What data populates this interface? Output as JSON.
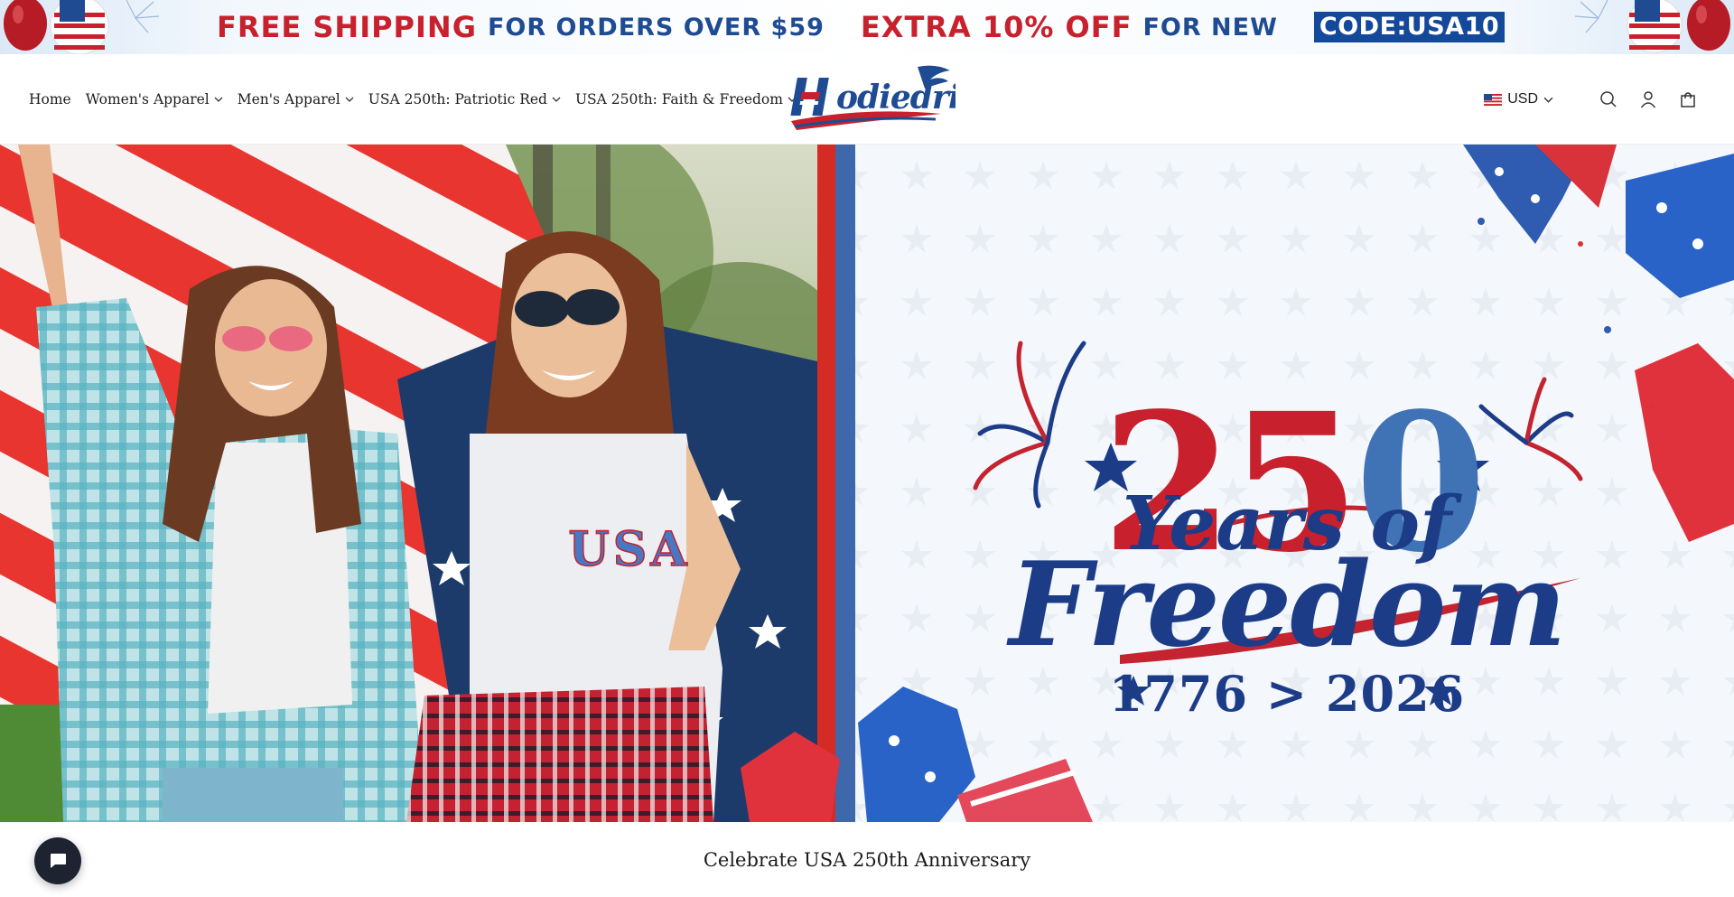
{
  "announcement": {
    "free_shipping": "FREE SHIPPING",
    "orders_over": "FOR ORDERS OVER $59",
    "extra_off": "EXTRA 10% OFF",
    "for_new": "FOR NEW",
    "code": "CODE:USA10"
  },
  "nav": {
    "items": [
      {
        "label": "Home",
        "has_dropdown": false
      },
      {
        "label": "Women's Apparel",
        "has_dropdown": true
      },
      {
        "label": "Men's Apparel",
        "has_dropdown": true
      },
      {
        "label": "USA 250th: Patriotic Red",
        "has_dropdown": true
      },
      {
        "label": "USA 250th: Faith & Freedom",
        "has_dropdown": true
      }
    ]
  },
  "logo": {
    "text": "Hoodiedrip"
  },
  "utilities": {
    "currency": "USD",
    "icons": [
      "search-icon",
      "account-icon",
      "cart-icon"
    ]
  },
  "hero": {
    "number": "250",
    "line1": "Years of",
    "line2": "Freedom",
    "dates": "1776 > 2026",
    "shirt_text": "USA"
  },
  "section": {
    "caption": "Celebrate USA 250th Anniversary"
  },
  "colors": {
    "red": "#c8202c",
    "blue": "#1f4b93",
    "navy": "#1d3c88",
    "code_bg": "#14489a"
  }
}
